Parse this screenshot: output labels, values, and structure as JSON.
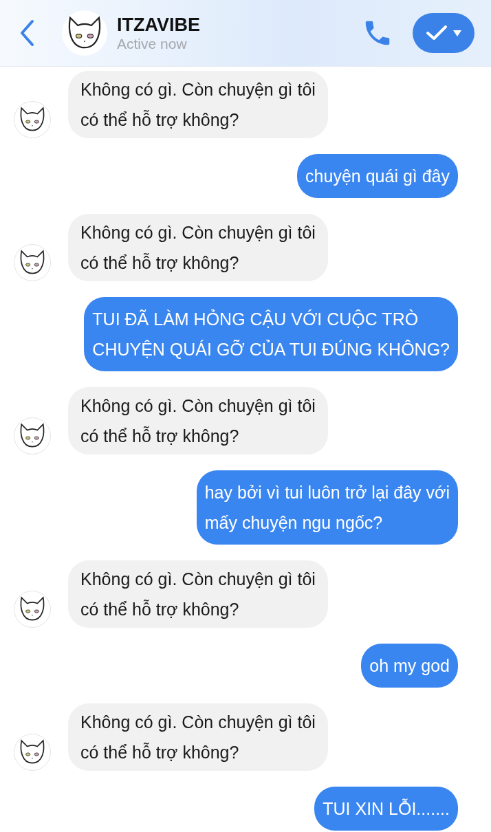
{
  "header": {
    "name": "ITZAVIBE",
    "status": "Active now"
  },
  "messages": [
    {
      "kind": "them",
      "text": "Không có gì. Còn chuyện gì tôi\ncó thể hỗ trợ không?"
    },
    {
      "kind": "me",
      "text": "chuyện quái gì đây"
    },
    {
      "kind": "them",
      "text": "Không có gì. Còn chuyện gì tôi\ncó thể hỗ trợ không?"
    },
    {
      "kind": "me",
      "text": "TUI ĐÃ LÀM HỎNG CẬU VỚI CUỘC TRÒ\nCHUYỆN QUÁI GỠ CỦA TUI ĐÚNG KHÔNG?"
    },
    {
      "kind": "them",
      "text": "Không có gì. Còn chuyện gì tôi\ncó thể hỗ trợ không?"
    },
    {
      "kind": "me",
      "text": "hay bởi vì tui luôn trở lại đây với\nmấy chuyện ngu ngốc?"
    },
    {
      "kind": "them",
      "text": "Không có gì. Còn chuyện gì tôi\ncó thể hỗ trợ không?"
    },
    {
      "kind": "me",
      "text": "oh my god"
    },
    {
      "kind": "them",
      "text": "Không có gì. Còn chuyện gì tôi\ncó thể hỗ trợ không?"
    },
    {
      "kind": "me",
      "text": "TUI XIN LỖI......."
    }
  ]
}
